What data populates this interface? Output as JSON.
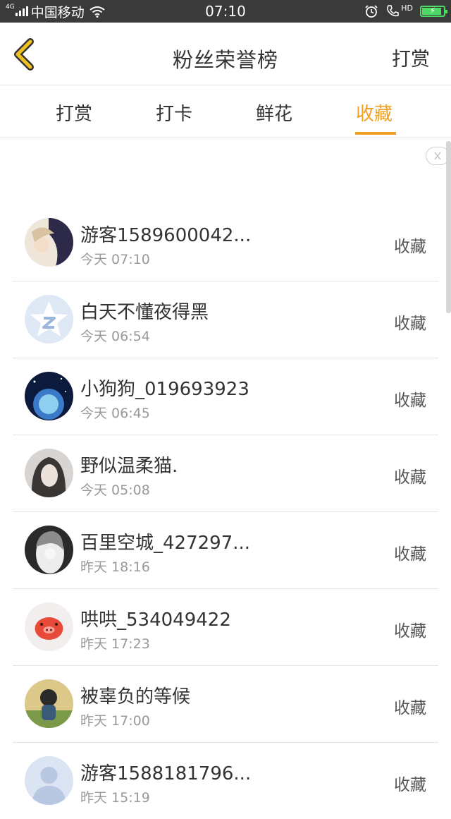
{
  "status_bar": {
    "network": "4G",
    "carrier": "中国移动",
    "time": "07:10",
    "hd": "HD",
    "battery_level": 0.9
  },
  "header": {
    "title": "粉丝荣誉榜",
    "action_label": "打赏",
    "back_icon": "chevron-left-icon"
  },
  "tabs": [
    {
      "label": "打赏",
      "active": false
    },
    {
      "label": "打卡",
      "active": false
    },
    {
      "label": "鲜花",
      "active": false
    },
    {
      "label": "收藏",
      "active": true
    }
  ],
  "colors": {
    "accent": "#f0a020",
    "text": "#333333",
    "secondary_text": "#999999",
    "divider": "#e6e6e6",
    "status_bar": "#3a3a3a",
    "battery": "#4cd964"
  },
  "list": [
    {
      "name": "游客1589600042...",
      "time": "今天 07:10",
      "action": "收藏"
    },
    {
      "name": "白天不懂夜得黑",
      "time": "今天 06:54",
      "action": "收藏"
    },
    {
      "name": "小狗狗_019693923",
      "time": "今天 06:45",
      "action": "收藏"
    },
    {
      "name": "野似温柔猫.",
      "time": "今天 05:08",
      "action": "收藏"
    },
    {
      "name": "百里空城_427297...",
      "time": "昨天 18:16",
      "action": "收藏"
    },
    {
      "name": "哄哄_534049422",
      "time": "昨天 17:23",
      "action": "收藏"
    },
    {
      "name": "被辜负的等候",
      "time": "昨天 17:00",
      "action": "收藏"
    },
    {
      "name": "游客1588181796...",
      "time": "昨天 15:19",
      "action": "收藏"
    }
  ]
}
